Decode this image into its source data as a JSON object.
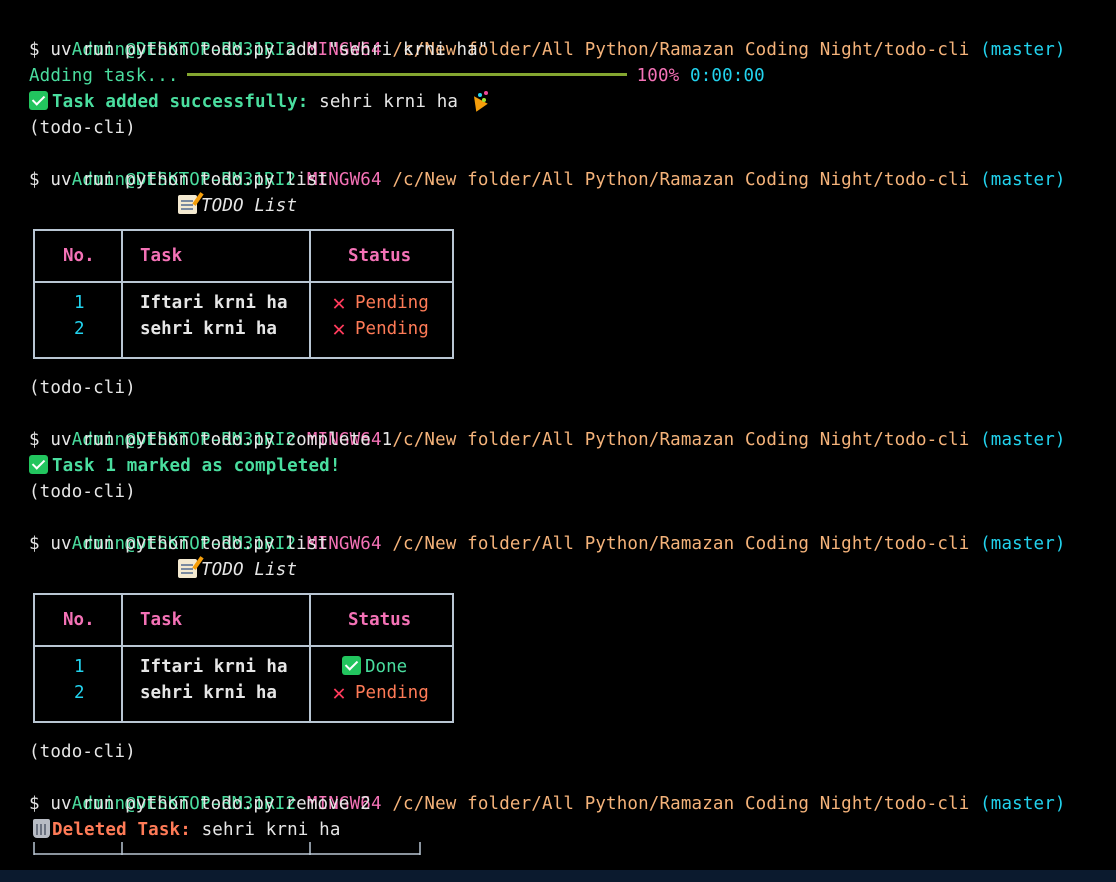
{
  "prompt": {
    "user_host": "Admin@DESKTOP-RM31RI2",
    "shell": "MINGW64",
    "path": "/c/New folder/All Python/Ramazan Coding Night/todo-cli",
    "branch": "(master)",
    "venv": "(todo-cli)",
    "symbol": "$"
  },
  "commands": {
    "add": "uv run python todo.py add \"sehri krni ha\"",
    "list": "uv run python todo.py list",
    "complete": "uv run python todo.py complete 1",
    "remove": "uv run python todo.py remove 2"
  },
  "progress": {
    "label": "Adding task...",
    "percent": "100%",
    "time": "0:00:00",
    "fraction": 1.0
  },
  "messages": {
    "added_label": "Task added successfully:",
    "added_value": "sehri krni ha",
    "completed": "Task 1 marked as completed!",
    "deleted_label": "Deleted Task:",
    "deleted_value": "sehri krni ha"
  },
  "table_title": "TODO List",
  "table_headers": {
    "no": "No.",
    "task": "Task",
    "status": "Status"
  },
  "tables": [
    {
      "rows": [
        {
          "no": "1",
          "task": "Iftari krni ha",
          "status": "Pending"
        },
        {
          "no": "2",
          "task": "sehri krni ha",
          "status": "Pending"
        }
      ]
    },
    {
      "rows": [
        {
          "no": "1",
          "task": "Iftari krni ha",
          "status": "Done"
        },
        {
          "no": "2",
          "task": "sehri krni ha",
          "status": "Pending"
        }
      ]
    }
  ],
  "icons": {
    "check": "check-mark-icon",
    "cross": "cross-mark-icon",
    "memo": "memo-icon",
    "party": "party-popper-icon",
    "trash": "wastebasket-icon"
  },
  "colors": {
    "background": "#000000",
    "prompt_user": "#4ade9f",
    "prompt_shell": "#f472b6",
    "prompt_path": "#f5b37a",
    "prompt_branch": "#22d3ee",
    "pending": "#ff7b57",
    "done": "#4ade9f",
    "table_border": "#b9c6d3",
    "progress_bar": "#84a630"
  }
}
